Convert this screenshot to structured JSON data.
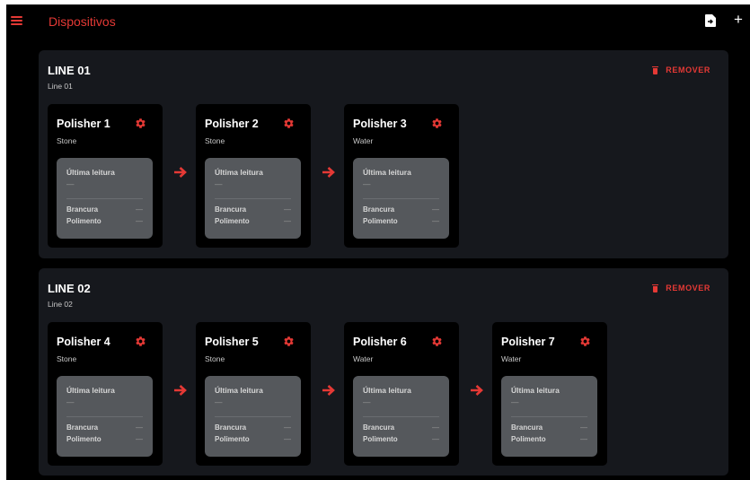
{
  "header": {
    "title": "Dispositivos",
    "menu_icon": "hamburger-menu-icon",
    "export_icon": "file-export-icon",
    "add_label": "+"
  },
  "colors": {
    "accent": "#e53935",
    "background": "#000000",
    "panel": "#16181d",
    "card": "#000000",
    "reading": "#55585c"
  },
  "labels": {
    "reading": "Última leitura",
    "whiteness": "Brancura",
    "polishing": "Polimento",
    "empty": "—",
    "remove": "REMOVER"
  },
  "lines": [
    {
      "title": "LINE 01",
      "subtitle": "Line 01",
      "devices": [
        {
          "name": "Polisher 1",
          "type": "Stone"
        },
        {
          "name": "Polisher 2",
          "type": "Stone"
        },
        {
          "name": "Polisher 3",
          "type": "Water"
        }
      ]
    },
    {
      "title": "LINE 02",
      "subtitle": "Line 02",
      "devices": [
        {
          "name": "Polisher 4",
          "type": "Stone"
        },
        {
          "name": "Polisher 5",
          "type": "Stone"
        },
        {
          "name": "Polisher 6",
          "type": "Water"
        },
        {
          "name": "Polisher 7",
          "type": "Water"
        }
      ]
    }
  ]
}
